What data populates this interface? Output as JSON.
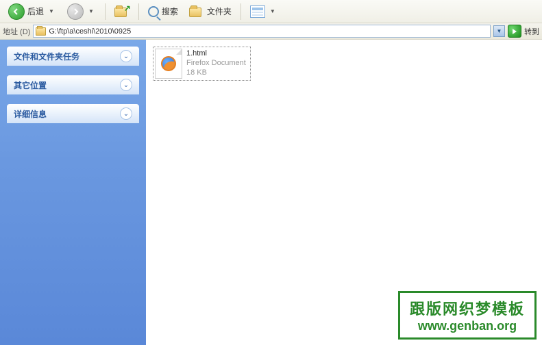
{
  "toolbar": {
    "back_label": "后退",
    "search_label": "搜索",
    "folders_label": "文件夹"
  },
  "addressbar": {
    "label": "地址 (D)",
    "path": "G:\\ftp\\a\\ceshi\\2010\\0925",
    "go_label": "转到"
  },
  "sidebar": {
    "panels": [
      {
        "title": "文件和文件夹任务"
      },
      {
        "title": "其它位置"
      },
      {
        "title": "详细信息"
      }
    ]
  },
  "content": {
    "files": [
      {
        "name": "1.html",
        "type": "Firefox Document",
        "size": "18 KB"
      }
    ]
  },
  "watermark": {
    "line1": "跟版网织梦模板",
    "line2": "www.genban.org"
  }
}
